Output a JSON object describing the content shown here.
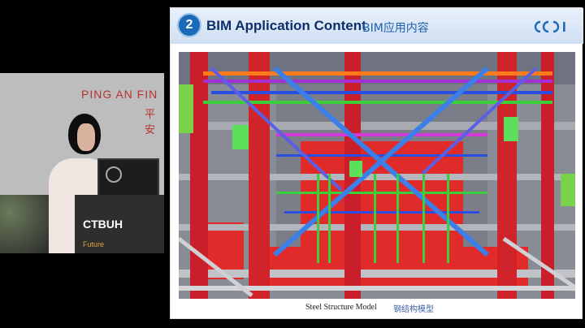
{
  "video": {
    "banner_line1": "PING AN FIN",
    "banner_line2": "平安",
    "podium_title": "CTBUH",
    "podium_sub": "Future"
  },
  "slide": {
    "section_number": "2",
    "title_en": "BIM Application Content",
    "title_cn": "BIM应用内容",
    "logo_text": "CCDI",
    "caption_en": "Steel Structure Model",
    "caption_cn": "钢结构模型"
  },
  "colors": {
    "accent_blue": "#1b6bb8",
    "title_navy": "#0e2f6a",
    "structure_red": "#e12a2a",
    "beam_green": "#3ccf3c",
    "beam_blue": "#2a4fe0",
    "beam_purple": "#a52fd6",
    "beam_orange": "#ff7a1a"
  }
}
